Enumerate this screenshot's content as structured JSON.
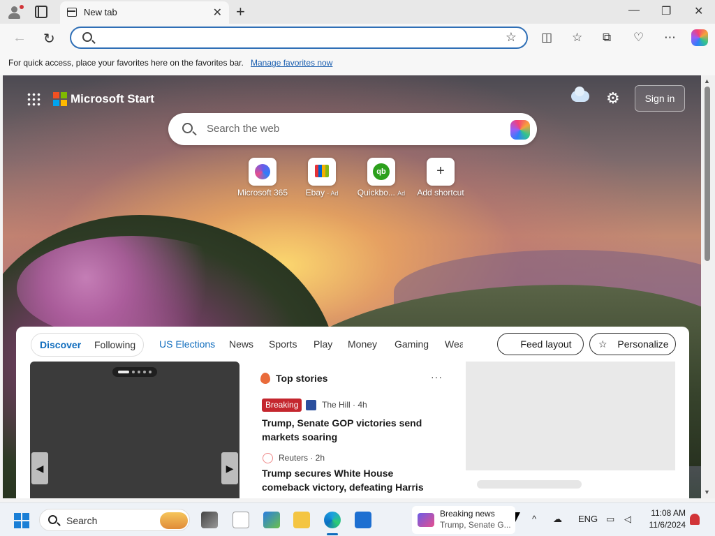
{
  "browser": {
    "tab_title": "New tab",
    "new_tab_symbol": "+",
    "close_symbol": "✕",
    "window_controls": {
      "minimize": "—",
      "maximize": "❐",
      "close": "✕"
    },
    "address_value": "",
    "address_placeholder": "",
    "favorites_message": "For quick access, place your favorites here on the favorites bar.",
    "favorites_link": "Manage favorites now",
    "toolbar_icons": [
      "split-screen-icon",
      "favorites-icon",
      "collections-icon",
      "browser-essentials-icon",
      "more-icon",
      "copilot-icon"
    ]
  },
  "start": {
    "brand": "Microsoft Start",
    "signin": "Sign in",
    "search_placeholder": "Search the web",
    "shortcuts": [
      {
        "label": "Microsoft 365",
        "ad": ""
      },
      {
        "label": "Ebay",
        "ad": "· Ad"
      },
      {
        "label": "Quickbo...",
        "ad": "Ad"
      },
      {
        "label": "Add shortcut",
        "ad": ""
      }
    ]
  },
  "feed": {
    "pill": {
      "discover": "Discover",
      "following": "Following"
    },
    "tabs": [
      "US Elections",
      "News",
      "Sports",
      "Play",
      "Money",
      "Gaming",
      "Wea"
    ],
    "feed_layout": "Feed layout",
    "personalize": "Personalize",
    "top_stories": {
      "title": "Top stories",
      "more": "···",
      "items": [
        {
          "badge": "Breaking",
          "source": "The Hill · 4h",
          "headline": "Trump, Senate GOP victories send markets soaring"
        },
        {
          "badge": "",
          "source": "Reuters · 2h",
          "headline": "Trump secures White House comeback victory, defeating Harris"
        }
      ]
    },
    "carousel_prev": "◀",
    "carousel_next": "▶"
  },
  "taskbar": {
    "search_label": "Search",
    "news_title": "Breaking news",
    "news_sub": "Trump, Senate G...",
    "lang": "ENG",
    "time": "11:08 AM",
    "date": "11/6/2024",
    "tray_chevron": "^"
  },
  "colors": {
    "accent": "#2f6fb6",
    "link": "#1b5fb0",
    "breaking": "#c4262e",
    "tab_selected": "#0f6cbd"
  }
}
